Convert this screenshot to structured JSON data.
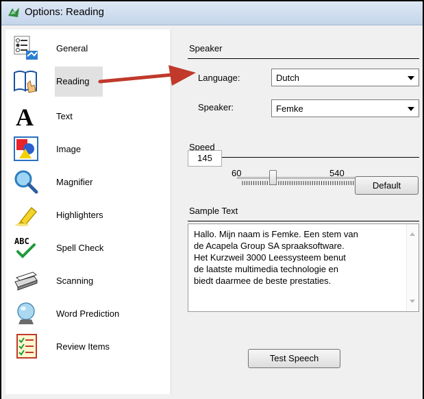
{
  "window": {
    "title": "Options: Reading"
  },
  "sidebar": {
    "items": [
      {
        "label": "General",
        "icon": "options-list-icon"
      },
      {
        "label": "Reading",
        "icon": "book-hand-icon",
        "selected": true
      },
      {
        "label": "Text",
        "icon": "letter-a-icon"
      },
      {
        "label": "Image",
        "icon": "shapes-icon"
      },
      {
        "label": "Magnifier",
        "icon": "magnifier-icon"
      },
      {
        "label": "Highlighters",
        "icon": "highlighter-icon"
      },
      {
        "label": "Spell Check",
        "icon": "spell-check-icon"
      },
      {
        "label": "Scanning",
        "icon": "scanner-icon"
      },
      {
        "label": "Word Prediction",
        "icon": "crystal-ball-icon"
      },
      {
        "label": "Review Items",
        "icon": "checklist-icon"
      }
    ]
  },
  "speaker": {
    "section_title": "Speaker",
    "language_label": "Language:",
    "language_value": "Dutch",
    "speaker_label": "Speaker:",
    "speaker_value": "Femke"
  },
  "speed": {
    "section_title": "Speed",
    "current": "145",
    "min_label": "60",
    "max_label": "540",
    "default_button": "Default",
    "slider_value": 145,
    "slider_min": 60,
    "slider_max": 540
  },
  "sample": {
    "section_title": "Sample Text",
    "text": "Hallo. Mijn naam is Femke. Een stem van\nde Acapela Group SA spraaksoftware.\nHet Kurzweil 3000 Leessysteem benut\nde laatste multimedia technologie en\nbiedt daarmee de beste prestaties."
  },
  "test_button": "Test Speech",
  "colors": {
    "annotation_arrow": "#c0392b",
    "selection": "#e1e1e1"
  }
}
